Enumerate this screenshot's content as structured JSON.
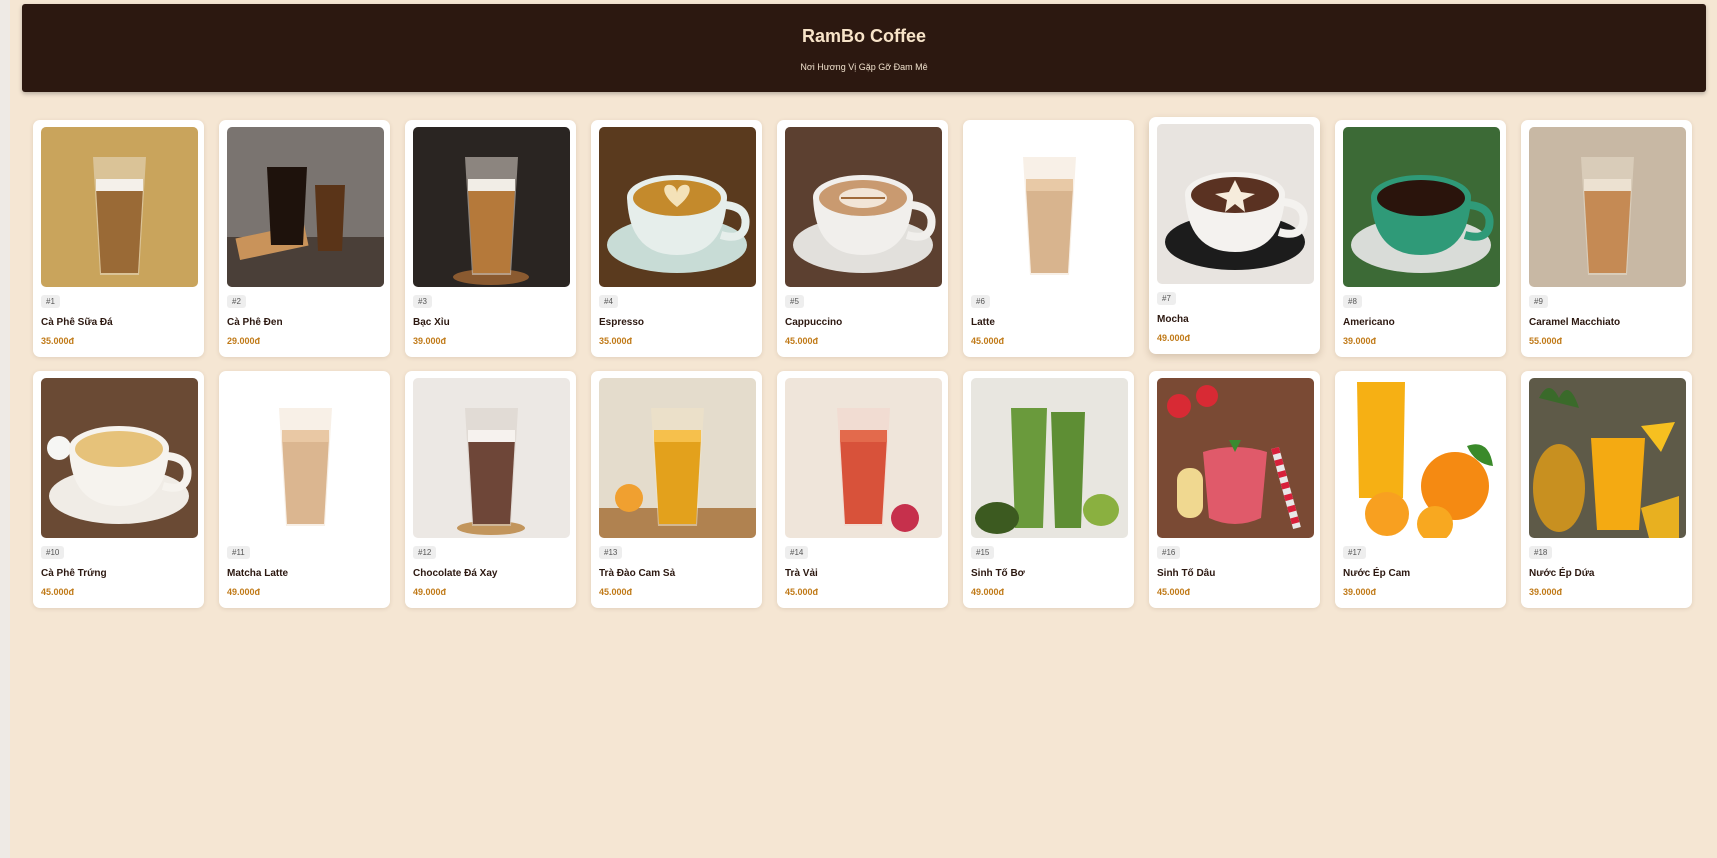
{
  "header": {
    "title": "RamBo Coffee",
    "tagline": "Nơi Hương Vị Gặp Gỡ Đam Mê"
  },
  "products": [
    {
      "number": "#1",
      "name": "Cà Phê Sữa Đá",
      "price": "35.000đ",
      "image_icon": "iced-milk-coffee-icon"
    },
    {
      "number": "#2",
      "name": "Cà Phê Đen",
      "price": "29.000đ",
      "image_icon": "iced-black-coffee-icon"
    },
    {
      "number": "#3",
      "name": "Bạc Xỉu",
      "price": "39.000đ",
      "image_icon": "bac-xiu-icon"
    },
    {
      "number": "#4",
      "name": "Espresso",
      "price": "35.000đ",
      "image_icon": "espresso-cup-icon"
    },
    {
      "number": "#5",
      "name": "Cappuccino",
      "price": "45.000đ",
      "image_icon": "cappuccino-cup-icon"
    },
    {
      "number": "#6",
      "name": "Latte",
      "price": "45.000đ",
      "image_icon": "iced-latte-icon"
    },
    {
      "number": "#7",
      "name": "Mocha",
      "price": "49.000đ",
      "image_icon": "mocha-cup-icon"
    },
    {
      "number": "#8",
      "name": "Americano",
      "price": "39.000đ",
      "image_icon": "americano-cup-icon"
    },
    {
      "number": "#9",
      "name": "Caramel Macchiato",
      "price": "55.000đ",
      "image_icon": "caramel-macchiato-icon"
    },
    {
      "number": "#10",
      "name": "Cà Phê Trứng",
      "price": "45.000đ",
      "image_icon": "egg-coffee-icon"
    },
    {
      "number": "#11",
      "name": "Matcha Latte",
      "price": "49.000đ",
      "image_icon": "matcha-latte-icon"
    },
    {
      "number": "#12",
      "name": "Chocolate Đá Xay",
      "price": "49.000đ",
      "image_icon": "chocolate-frappe-icon"
    },
    {
      "number": "#13",
      "name": "Trà Đào Cam Sả",
      "price": "45.000đ",
      "image_icon": "peach-tea-icon"
    },
    {
      "number": "#14",
      "name": "Trà Vải",
      "price": "45.000đ",
      "image_icon": "lychee-tea-icon"
    },
    {
      "number": "#15",
      "name": "Sinh Tố Bơ",
      "price": "49.000đ",
      "image_icon": "avocado-smoothie-icon"
    },
    {
      "number": "#16",
      "name": "Sinh Tố Dâu",
      "price": "45.000đ",
      "image_icon": "strawberry-smoothie-icon"
    },
    {
      "number": "#17",
      "name": "Nước Ép Cam",
      "price": "39.000đ",
      "image_icon": "orange-juice-icon"
    },
    {
      "number": "#18",
      "name": "Nước Ép Dứa",
      "price": "39.000đ",
      "image_icon": "pineapple-juice-icon"
    }
  ],
  "colors": {
    "header_bg": "#2c1810",
    "page_bg": "#f5e6d3",
    "price": "#c07a18"
  }
}
